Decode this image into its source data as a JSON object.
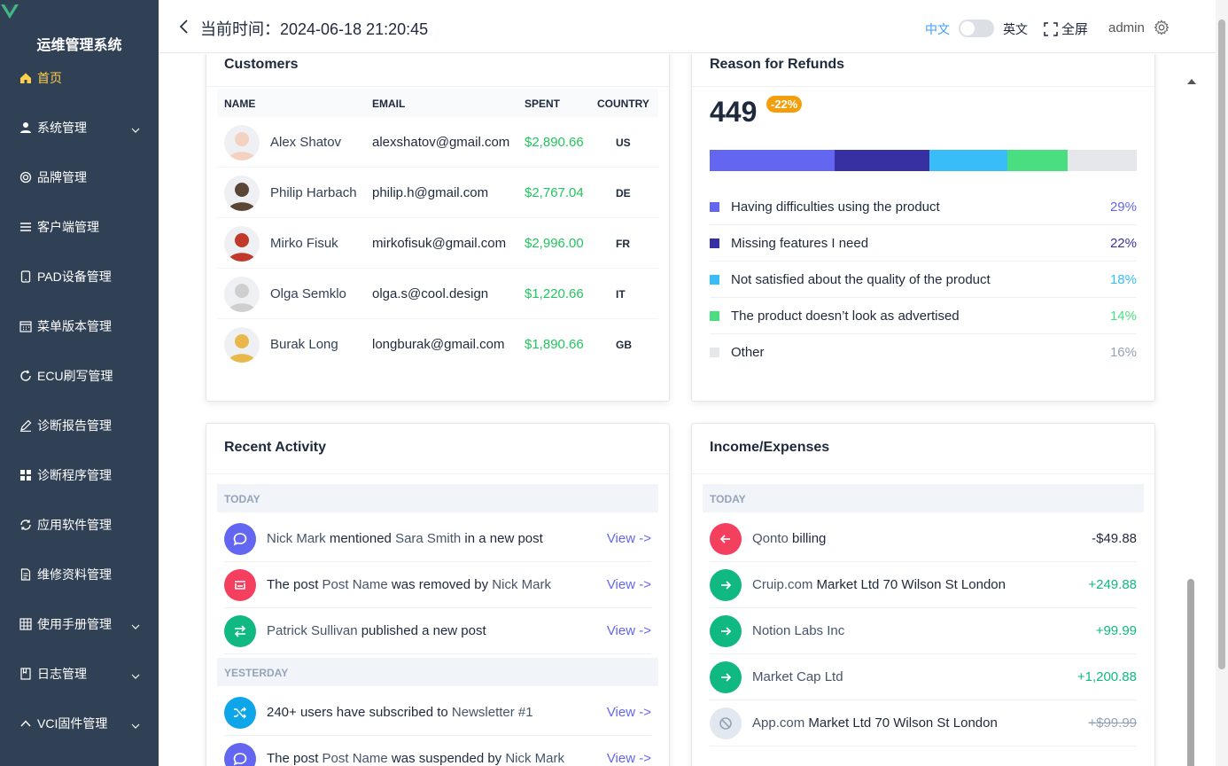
{
  "app": {
    "title": "运维管理系统"
  },
  "sidebar": {
    "items": [
      {
        "label": "首页",
        "icon": "home-icon",
        "active": true,
        "expandable": false
      },
      {
        "label": "系统管理",
        "icon": "user-icon",
        "expandable": true
      },
      {
        "label": "品牌管理",
        "icon": "brand-icon",
        "expandable": false
      },
      {
        "label": "客户端管理",
        "icon": "list-icon",
        "expandable": false
      },
      {
        "label": "PAD设备管理",
        "icon": "tablet-icon",
        "expandable": false
      },
      {
        "label": "菜单版本管理",
        "icon": "calendar-icon",
        "expandable": false
      },
      {
        "label": "ECU刷写管理",
        "icon": "refresh-icon",
        "expandable": false
      },
      {
        "label": "诊断报告管理",
        "icon": "pen-icon",
        "expandable": false
      },
      {
        "label": "诊断程序管理",
        "icon": "grid-icon",
        "expandable": false
      },
      {
        "label": "应用软件管理",
        "icon": "sync-icon",
        "expandable": false
      },
      {
        "label": "维修资料管理",
        "icon": "document-icon",
        "expandable": false
      },
      {
        "label": "使用手册管理",
        "icon": "table-icon",
        "expandable": true
      },
      {
        "label": "日志管理",
        "icon": "log-icon",
        "expandable": true
      },
      {
        "label": "VCI固件管理",
        "icon": "chevron-up-icon",
        "expandable": true
      }
    ]
  },
  "header": {
    "time": "当前时间：2024-06-18 21:20:45",
    "lang_zh": "中文",
    "lang_en": "英文",
    "fullscreen": "全屏",
    "user": "admin"
  },
  "customers": {
    "title": "Customers",
    "columns": [
      "NAME",
      "EMAIL",
      "SPENT",
      "COUNTRY"
    ],
    "rows": [
      {
        "name": "Alex Shatov",
        "email": "alexshatov@gmail.com",
        "spent": "$2,890.66",
        "country": "US",
        "avatar_color": "#f3d2c1"
      },
      {
        "name": "Philip Harbach",
        "email": "philip.h@gmail.com",
        "spent": "$2,767.04",
        "country": "DE",
        "avatar_color": "#5b4636"
      },
      {
        "name": "Mirko Fisuk",
        "email": "mirkofisuk@gmail.com",
        "spent": "$2,996.00",
        "country": "FR",
        "avatar_color": "#c0392b"
      },
      {
        "name": "Olga Semklo",
        "email": "olga.s@cool.design",
        "spent": "$1,220.66",
        "country": "IT",
        "avatar_color": "#cfcfcf"
      },
      {
        "name": "Burak Long",
        "email": "longburak@gmail.com",
        "spent": "$1,890.66",
        "country": "GB",
        "avatar_color": "#e8b84a"
      }
    ]
  },
  "refunds": {
    "title": "Reason for Refunds",
    "total": "449",
    "change": "-22%",
    "reasons": [
      {
        "label": "Having difficulties using the product",
        "percent": "29%",
        "value": 29,
        "color": "#6366f1"
      },
      {
        "label": "Missing features I need",
        "percent": "22%",
        "value": 22,
        "color": "#3730a3"
      },
      {
        "label": "Not satisfied about the quality of the product",
        "percent": "18%",
        "value": 18,
        "color": "#38bdf8"
      },
      {
        "label": "The product doesn’t look as advertised",
        "percent": "14%",
        "value": 14,
        "color": "#4ade80"
      },
      {
        "label": "Other",
        "percent": "16%",
        "value": 16,
        "color": "#e5e7eb"
      }
    ]
  },
  "activity": {
    "title": "Recent Activity",
    "today_label": "TODAY",
    "yesterday_label": "YESTERDAY",
    "view_label": "View ->",
    "today": [
      {
        "parts": [
          "Nick Mark",
          " mentioned ",
          "Sara Smith",
          " in a new post"
        ],
        "icon": "chat-icon",
        "color": "#6366f1"
      },
      {
        "parts": [
          "The post ",
          "Post Name",
          " was removed by ",
          "Nick Mark"
        ],
        "icon": "trash-icon",
        "color": "#f43f5e"
      },
      {
        "parts": [
          "Patrick Sullivan",
          " published a new post",
          "",
          ""
        ],
        "icon": "swap-icon",
        "color": "#10b981"
      }
    ],
    "yesterday": [
      {
        "parts": [
          "240+ users have subscribed to ",
          "Newsletter #1",
          "",
          ""
        ],
        "icon": "shuffle-icon",
        "color": "#0ea5e9"
      },
      {
        "parts": [
          "The post ",
          "Post Name",
          " was suspended by ",
          "Nick Mark"
        ],
        "icon": "chat-icon",
        "color": "#6366f1"
      }
    ]
  },
  "income": {
    "title": "Income/Expenses",
    "today_label": "TODAY",
    "rows": [
      {
        "name": "Qonto",
        "rest": " billing",
        "amount": "-$49.88",
        "type": "out",
        "color": "#f43f5e",
        "amount_color": "#1e293b"
      },
      {
        "name": "Cruip.com",
        "rest": " Market Ltd 70 Wilson St London",
        "amount": "+249.88",
        "type": "in",
        "color": "#10b981",
        "amount_color": "#10b981"
      },
      {
        "name": "Notion Labs Inc",
        "rest": "",
        "amount": "+99.99",
        "type": "in",
        "color": "#10b981",
        "amount_color": "#10b981"
      },
      {
        "name": "Market Cap Ltd",
        "rest": "",
        "amount": "+1,200.88",
        "type": "in",
        "color": "#10b981",
        "amount_color": "#10b981"
      },
      {
        "name": "App.com",
        "rest": " Market Ltd 70 Wilson St London",
        "amount": "+$99.99",
        "type": "void",
        "color": "#e2e8f0",
        "amount_color": "#94a3b8"
      }
    ]
  }
}
